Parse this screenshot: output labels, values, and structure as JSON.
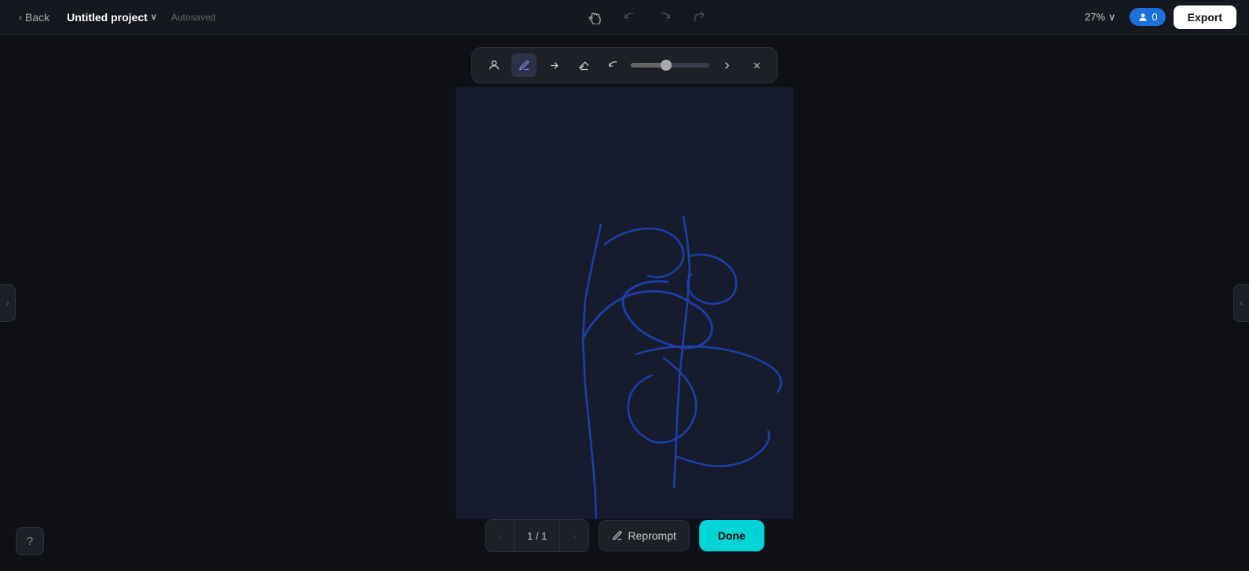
{
  "topbar": {
    "back_label": "Back",
    "project_title": "Untitled project",
    "autosaved_label": "Autosaved",
    "zoom_value": "27%",
    "users_count": "0",
    "export_label": "Export"
  },
  "annotation_toolbar": {
    "person_icon": "👤",
    "pen_icon": "✏️",
    "arrow_icon": "↗",
    "eraser_icon": "◻",
    "undo_arrow_icon": "↺",
    "redo_arrow_icon": "↻",
    "close_icon": "✕"
  },
  "side_toggles": {
    "left_chevron": "›",
    "right_chevron": "‹"
  },
  "bottom_bar": {
    "page_current": "1",
    "page_total": "1",
    "page_label": "1 / 1",
    "reprompt_label": "Reprompt",
    "done_label": "Done",
    "prev_icon": "‹",
    "next_icon": "›"
  },
  "toolbar": {
    "undo_label": "Undo",
    "redo_label": "Redo",
    "pan_label": "Pan"
  },
  "help": {
    "icon": "?"
  }
}
